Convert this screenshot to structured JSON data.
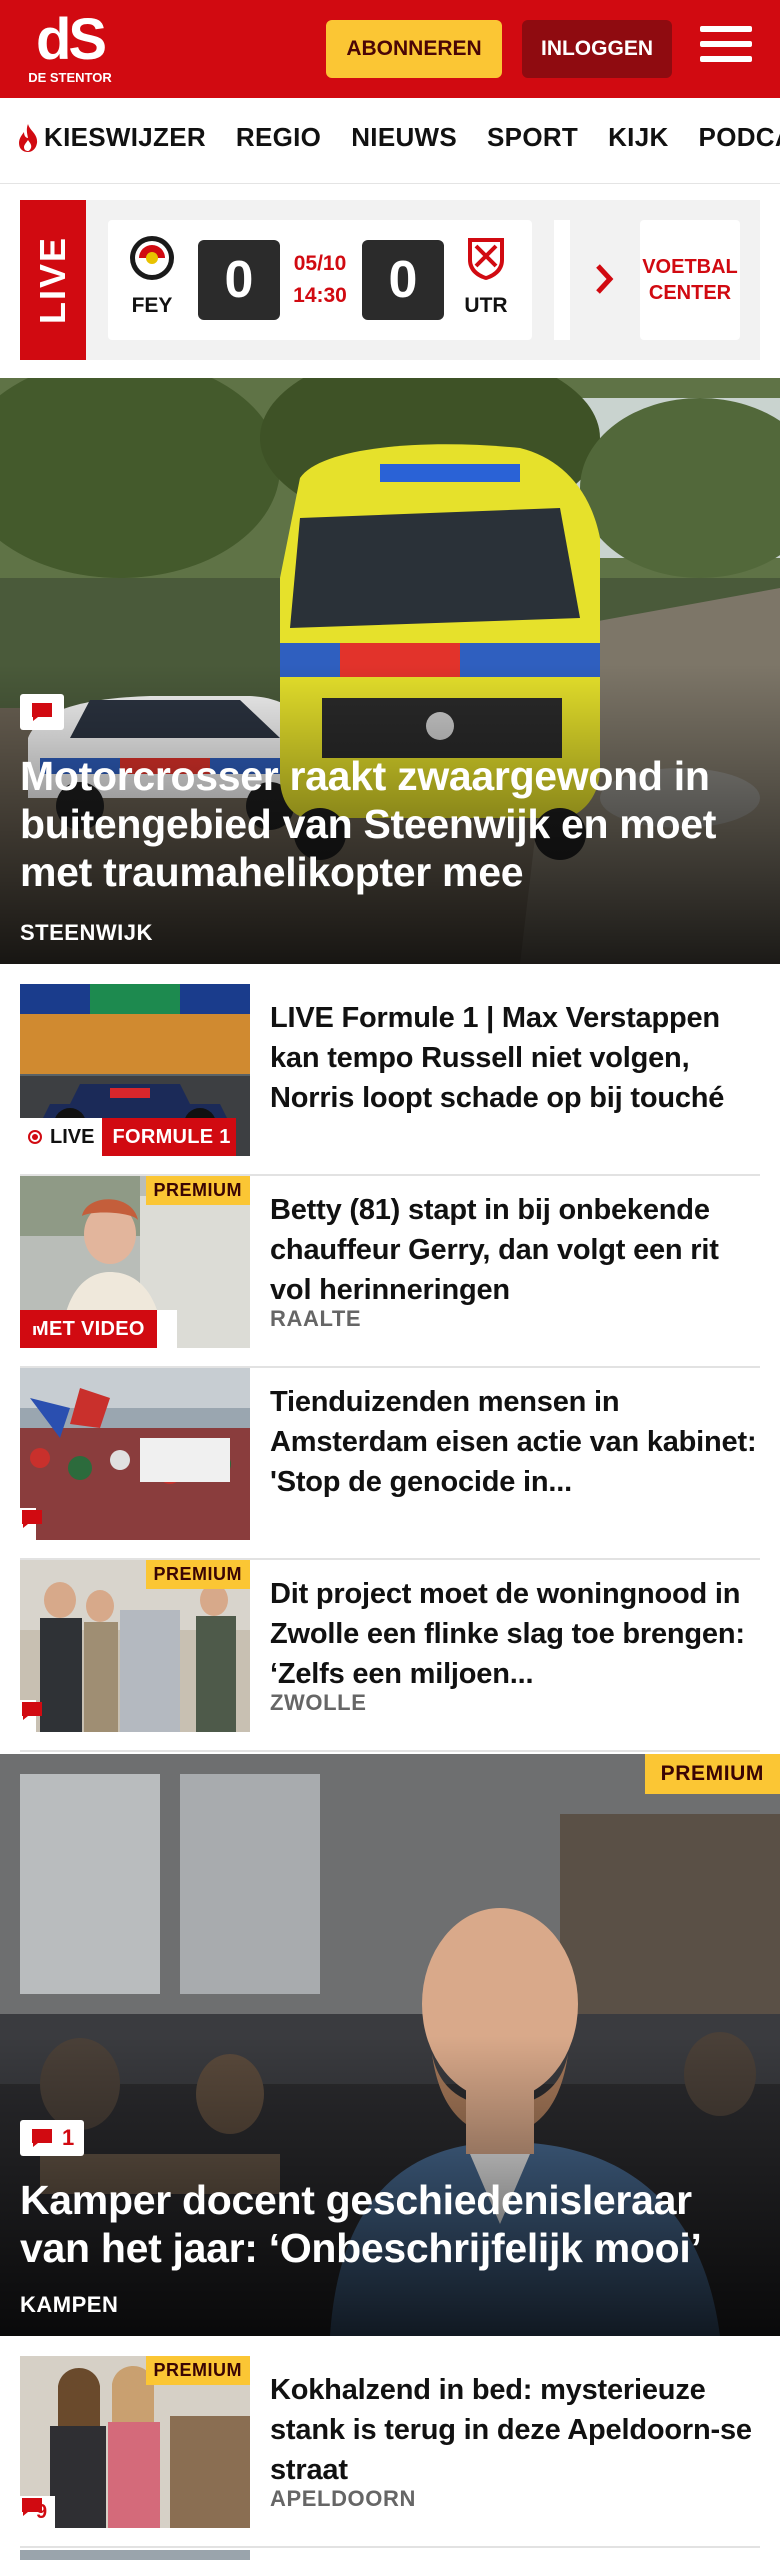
{
  "header": {
    "logo_mark": "dS",
    "logo_sub": "DE STENTOR",
    "subscribe_label": "ABONNEREN",
    "login_label": "INLOGGEN",
    "menu_icon": "hamburger-menu-icon",
    "brand_color": "#d10a11",
    "accent_color": "#fbc634"
  },
  "nav": {
    "items": [
      "KIESWIJZER",
      "REGIO",
      "NIEUWS",
      "SPORT",
      "KIJK",
      "PODCASTS"
    ],
    "first_icon": "flame-icon"
  },
  "live": {
    "tag": "LIVE",
    "home_team": "FEY",
    "away_team": "UTR",
    "home_score": "0",
    "away_score": "0",
    "date": "05/10",
    "time": "14:30",
    "link_label": "VOETBAL CENTER"
  },
  "hero1": {
    "headline": "Motorcrosser raakt zwaargewond in buitengebied van Steenwijk en moet met traumahelikopter mee",
    "location": "STEENWIJK",
    "comment_icon": "comment-icon"
  },
  "articles": [
    {
      "headline": "LIVE Formule 1 | Max Verstappen kan tempo Russell niet volgen, Norris loopt schade op bij touché",
      "live_label": "LIVE",
      "category": "FORMULE 1"
    },
    {
      "headline": "Betty (81) stapt in bij onbekende chauffeur Gerry, dan volgt een rit vol herinneringen",
      "location": "RAALTE",
      "premium": "PREMIUM",
      "video_label": "MET VIDEO"
    },
    {
      "headline": "Tienduizenden mensen in Amsterdam eisen actie van kabinet: 'Stop de genocide in...",
      "location": ""
    },
    {
      "headline": "Dit project moet de woningnood in Zwolle een flinke slag toe brengen: ‘Zelfs een miljoen...",
      "location": "ZWOLLE",
      "premium": "PREMIUM"
    }
  ],
  "hero2": {
    "headline": "Kamper docent geschiedenisleraar van het jaar: ‘Onbeschrijfelijk mooi’",
    "location": "KAMPEN",
    "premium": "PREMIUM",
    "comments": "1"
  },
  "article_last": {
    "headline": "Kokhalzend in bed: mysterieuze stank is terug in deze Apeldoorn-se straat",
    "location": "APELDOORN",
    "premium": "PREMIUM",
    "comments": "9"
  }
}
